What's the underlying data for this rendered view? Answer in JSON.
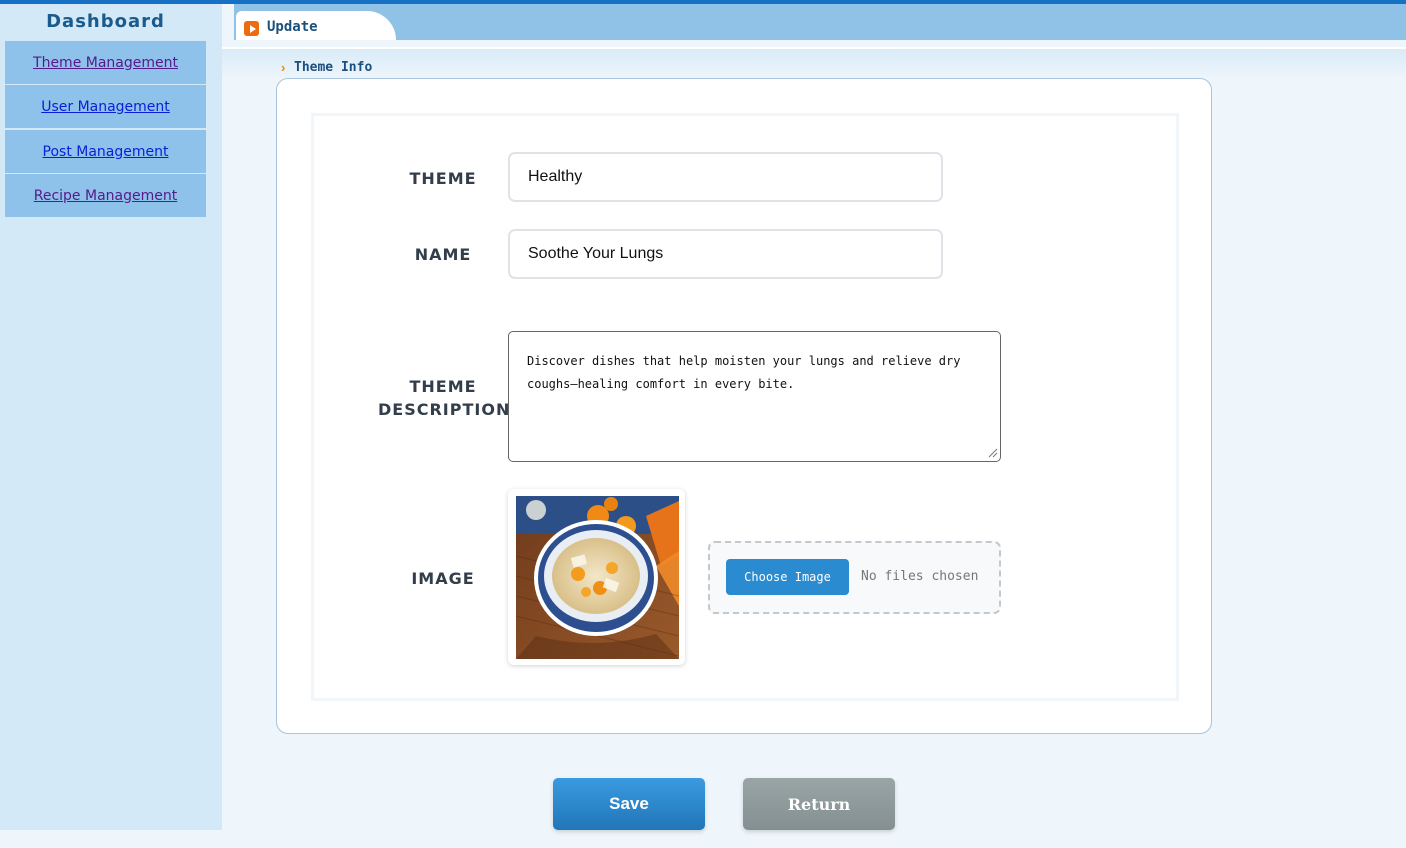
{
  "sidebar": {
    "title": "Dashboard",
    "items": [
      {
        "label": "Theme Management"
      },
      {
        "label": "User Management"
      },
      {
        "label": "Post Management"
      },
      {
        "label": "Recipe Management"
      }
    ]
  },
  "tab": {
    "label": "Update",
    "icon": "play-icon"
  },
  "breadcrumb": {
    "arrow": "›",
    "label": "Theme Info"
  },
  "form": {
    "theme_label": "THEME",
    "theme_value": "Healthy",
    "name_label": "NAME",
    "name_value": "Soothe Your Lungs",
    "description_label_line1": "THEME",
    "description_label_line2": "DESCRIPTION",
    "description_value": "Discover dishes that help moisten your lungs and relieve dry coughs—healing comfort in every bite.",
    "image_label": "IMAGE",
    "choose_button": "Choose Image",
    "file_status": "No files chosen"
  },
  "actions": {
    "save": "Save",
    "return": "Return"
  },
  "colors": {
    "accent": "#2b8bd0",
    "topbar": "#1670c4",
    "sidebar": "#d4e9f8",
    "nav_item": "#8fc2ea",
    "tab_icon": "#ee6a0f"
  }
}
